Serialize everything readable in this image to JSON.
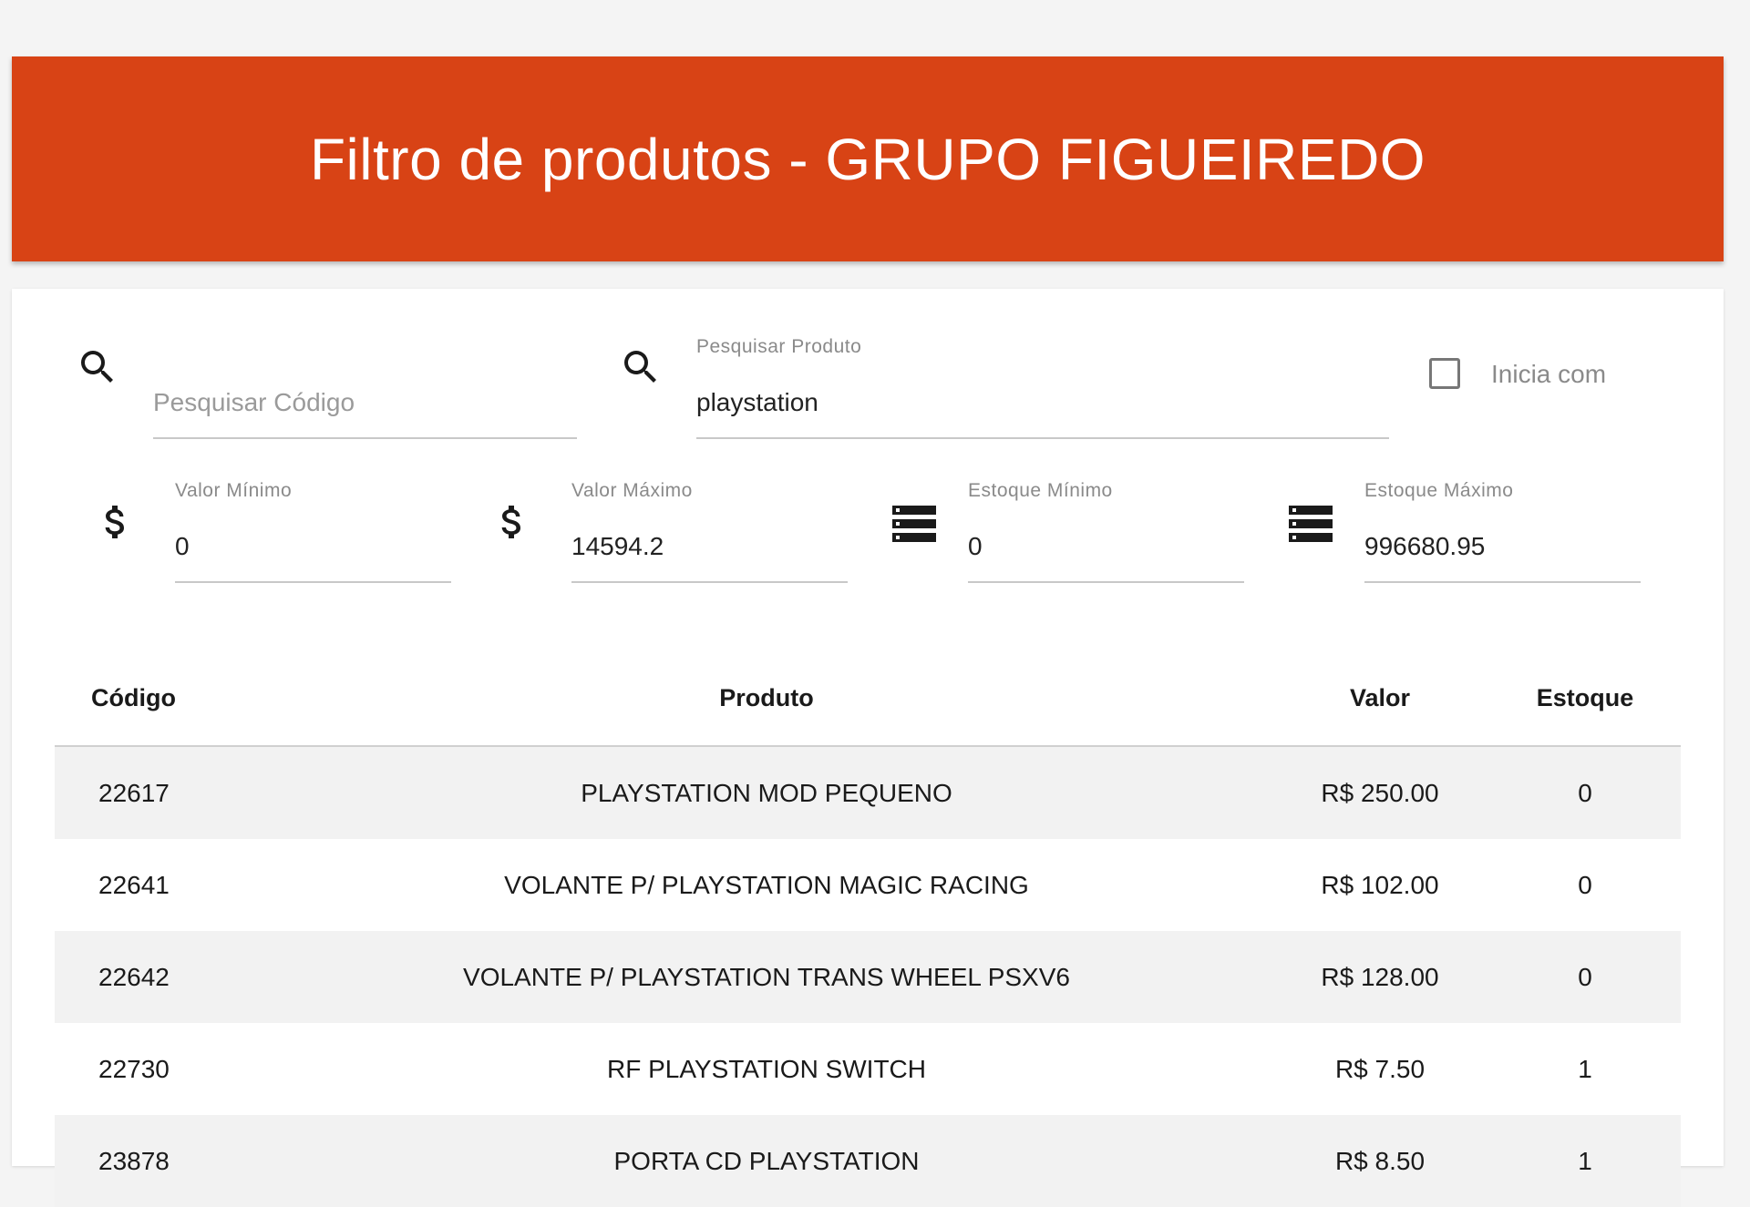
{
  "header": {
    "title": "Filtro de produtos - GRUPO FIGUEIREDO"
  },
  "filters": {
    "code_search": {
      "placeholder": "Pesquisar Código",
      "icon": "search-icon"
    },
    "product_search": {
      "label": "Pesquisar Produto",
      "value": "playstation",
      "icon": "search-icon"
    },
    "starts_with": {
      "label": "Inicia com",
      "checked": false
    },
    "min_value": {
      "label": "Valor Mínimo",
      "value": "0",
      "icon": "dollar-icon"
    },
    "max_value": {
      "label": "Valor Máximo",
      "value": "14594.2",
      "icon": "dollar-icon"
    },
    "min_stock": {
      "label": "Estoque Mínimo",
      "value": "0",
      "icon": "storage-icon"
    },
    "max_stock": {
      "label": "Estoque Máximo",
      "value": "996680.95",
      "icon": "storage-icon"
    }
  },
  "table": {
    "columns": [
      "Código",
      "Produto",
      "Valor",
      "Estoque"
    ],
    "rows": [
      {
        "code": "22617",
        "product": "PLAYSTATION MOD PEQUENO",
        "value": "R$ 250.00",
        "stock": "0"
      },
      {
        "code": "22641",
        "product": "VOLANTE P/ PLAYSTATION MAGIC RACING",
        "value": "R$ 102.00",
        "stock": "0"
      },
      {
        "code": "22642",
        "product": "VOLANTE P/ PLAYSTATION TRANS WHEEL PSXV6",
        "value": "R$ 128.00",
        "stock": "0"
      },
      {
        "code": "22730",
        "product": "RF PLAYSTATION SWITCH",
        "value": "R$ 7.50",
        "stock": "1"
      },
      {
        "code": "23878",
        "product": "PORTA CD PLAYSTATION",
        "value": "R$ 8.50",
        "stock": "1"
      }
    ]
  },
  "colors": {
    "header_bg": "#d84315",
    "header_text": "#ffffff",
    "striped_row": "#f2f2f2"
  }
}
